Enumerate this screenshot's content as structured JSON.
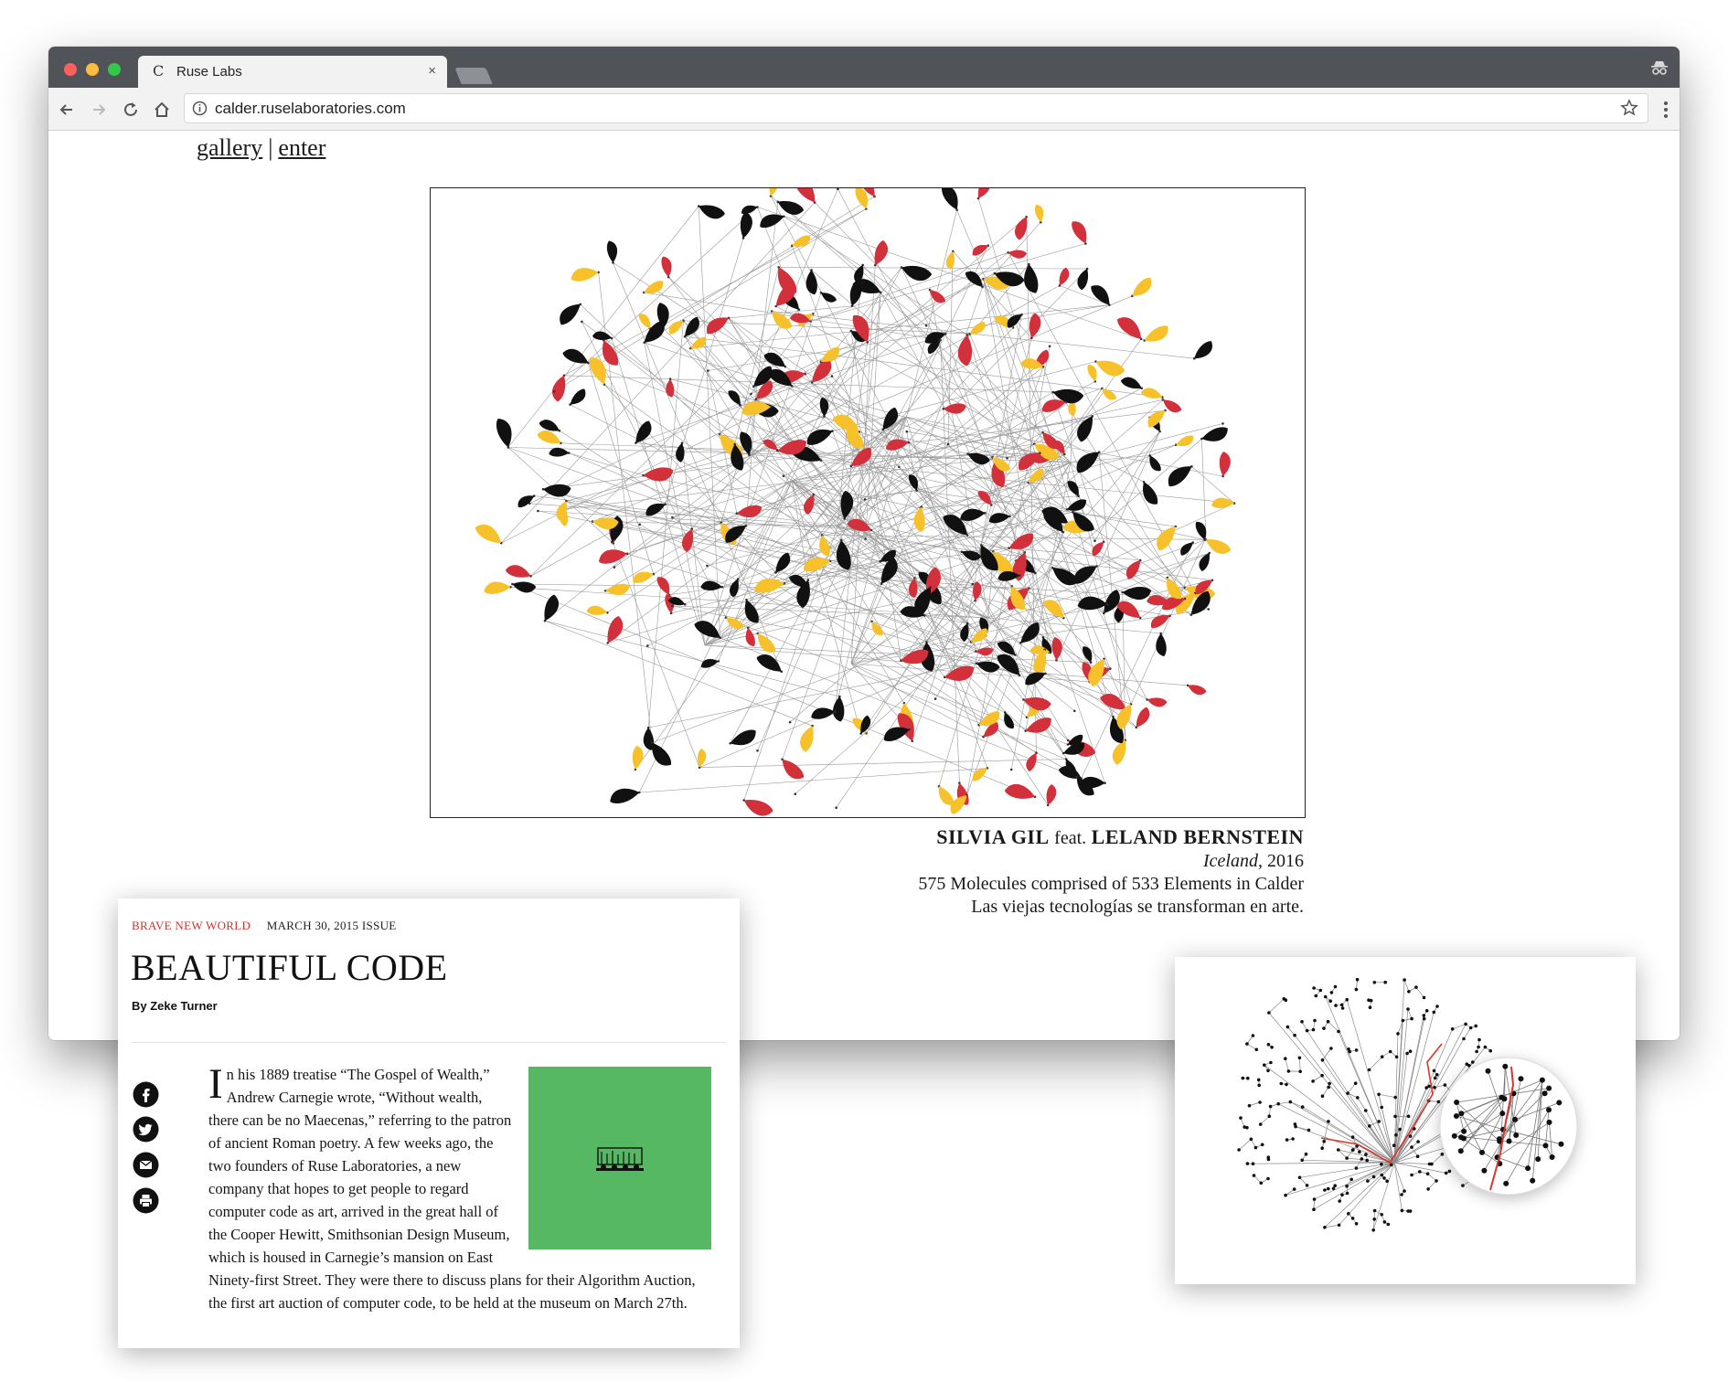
{
  "browser": {
    "tab_title": "Ruse Labs",
    "tab_favicon": "C",
    "tab_close": "×",
    "url": "calder.ruselaboratories.com"
  },
  "site": {
    "nav_gallery": "gallery",
    "nav_separator": "|",
    "nav_enter": "enter"
  },
  "artwork": {
    "artist": "SILVIA GIL",
    "feat": "feat.",
    "collaborator": "LELAND BERNSTEIN",
    "title": "Iceland,",
    "year": "2016",
    "description": "575 Molecules comprised of 533 Elements in Calder",
    "tagline": "Las viejas tecnologías se transforman en arte.",
    "colors": {
      "black": "#111111",
      "red": "#d2303a",
      "yellow": "#f7c12b",
      "wire": "#9a9a9a"
    }
  },
  "article": {
    "section": "BRAVE NEW WORLD",
    "issue": "MARCH 30, 2015 ISSUE",
    "title": "BEAUTIFUL CODE",
    "byline": "By Zeke Turner",
    "dropcap": "I",
    "body": "n his 1889 treatise “The Gospel of Wealth,” Andrew Carnegie wrote, “Without wealth, there can be no Maecenas,” referring to the patron of ancient Roman poetry. A few weeks ago, the two founders of Ruse Laboratories, a new company that hopes to get people to regard computer code as art, arrived in the great hall of the Cooper Hewitt, Smithsonian Design Museum, which is housed in Carnegie’s mansion on East Ninety-first Street. They were there to discuss plans for their Algorithm Auction, the first art auction of computer code, to be held at the museum on March 27th.",
    "figure_color": "#56b862",
    "share_icons": [
      "facebook-icon",
      "twitter-icon",
      "mail-icon",
      "print-icon"
    ]
  },
  "graph": {
    "highlight_color": "#d9342b",
    "node_color": "#111111"
  }
}
